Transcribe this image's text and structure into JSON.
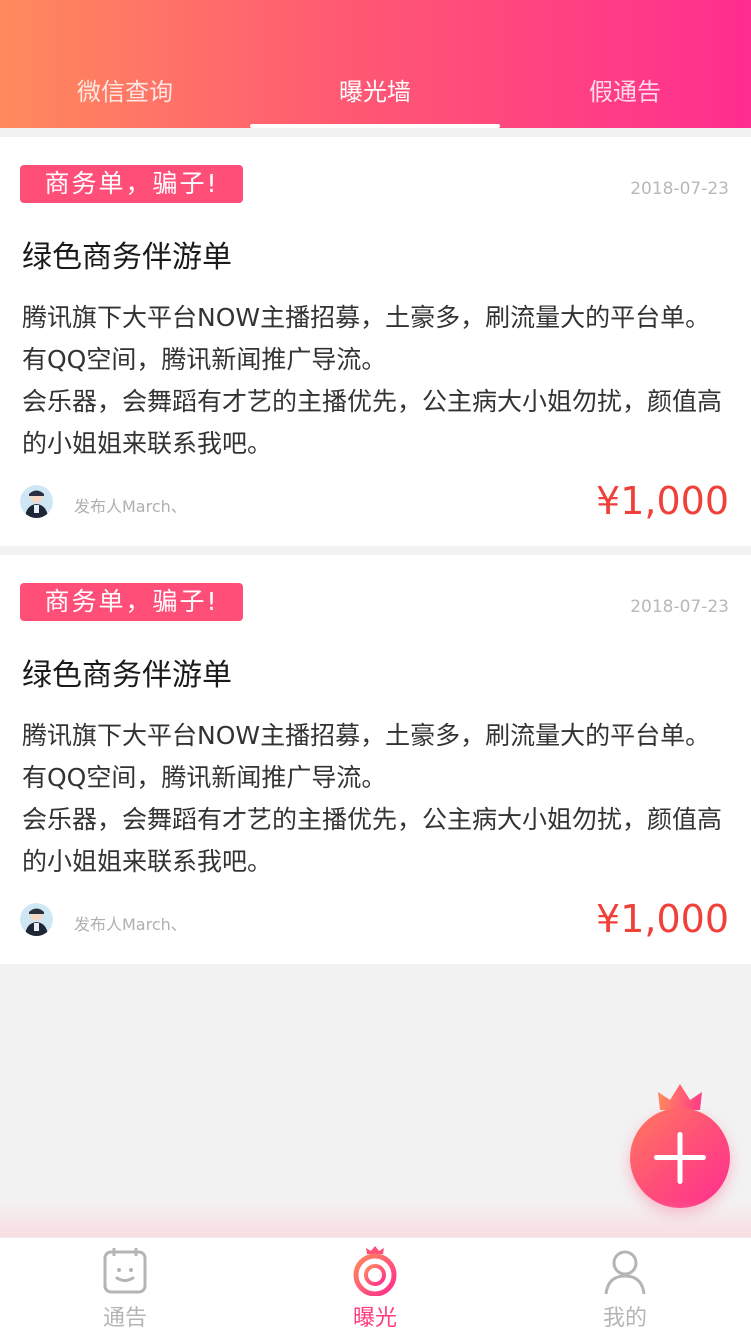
{
  "tabs": [
    {
      "label": "微信查询"
    },
    {
      "label": "曝光墙"
    },
    {
      "label": "假通告"
    }
  ],
  "active_tab": 1,
  "posts": [
    {
      "tag": "商务单，骗子!",
      "date": "2018-07-23",
      "title": "绿色商务伴游单",
      "description": "腾讯旗下大平台NOW主播招募，土豪多，刷流量大的平台单。有QQ空间，腾讯新闻推广导流。\n会乐器，会舞蹈有才艺的主播优先，公主病大小姐勿扰，颜值高的小姐姐来联系我吧。",
      "publisher": "发布人March、",
      "price": "¥1,000"
    },
    {
      "tag": "商务单，骗子!",
      "date": "2018-07-23",
      "title": "绿色商务伴游单",
      "description": "腾讯旗下大平台NOW主播招募，土豪多，刷流量大的平台单。有QQ空间，腾讯新闻推广导流。\n会乐器，会舞蹈有才艺的主播优先，公主病大小姐勿扰，颜值高的小姐姐来联系我吧。",
      "publisher": "发布人March、",
      "price": "¥1,000"
    }
  ],
  "fab": {
    "icon": "plus-icon"
  },
  "bottom_nav": [
    {
      "label": "通告",
      "icon": "notice-board-icon"
    },
    {
      "label": "曝光",
      "icon": "crown-ring-icon"
    },
    {
      "label": "我的",
      "icon": "user-icon"
    }
  ],
  "colors": {
    "accent": "#ff3b7c",
    "tag_bg": "#ff4f79",
    "price": "#f0403a",
    "header_start": "#ff8a5c",
    "header_end": "#ff2d8f"
  }
}
